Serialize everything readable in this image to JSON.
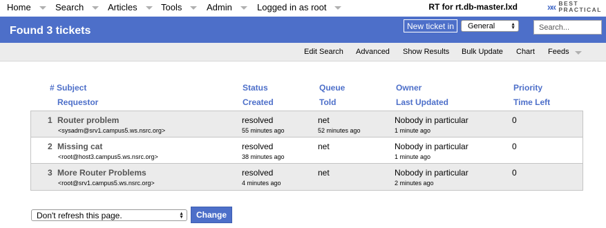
{
  "menu": {
    "items": [
      {
        "label": "Home"
      },
      {
        "label": "Search"
      },
      {
        "label": "Articles"
      },
      {
        "label": "Tools"
      },
      {
        "label": "Admin"
      },
      {
        "label": "Logged in as root"
      }
    ],
    "rt_title": "RT for rt.db-master.lxd",
    "logo_line1": "BEST",
    "logo_line2": "PRACTICAL"
  },
  "header": {
    "title": "Found 3 tickets",
    "new_ticket_label": "New ticket in",
    "queue_selected": "General",
    "search_placeholder": "Search..."
  },
  "subnav": {
    "items": [
      "Edit Search",
      "Advanced",
      "Show Results",
      "Bulk Update",
      "Chart",
      "Feeds"
    ]
  },
  "columns": {
    "row1": [
      "# Subject",
      "Status",
      "Queue",
      "Owner",
      "Priority"
    ],
    "row2": [
      "Requestor",
      "Created",
      "Told",
      "Last Updated",
      "Time Left"
    ]
  },
  "tickets": [
    {
      "id": "1",
      "subject": "Router problem",
      "status": "resolved",
      "queue": "net",
      "owner": "Nobody in particular",
      "priority": "0",
      "requestor": "<sysadm@srv1.campus5.ws.nsrc.org>",
      "created": "55 minutes ago",
      "told": "52 minutes ago",
      "last_updated": "1 minute ago",
      "time_left": ""
    },
    {
      "id": "2",
      "subject": "Missing cat",
      "status": "resolved",
      "queue": "net",
      "owner": "Nobody in particular",
      "priority": "0",
      "requestor": "<root@host3.campus5.ws.nsrc.org>",
      "created": "38 minutes ago",
      "told": "",
      "last_updated": "1 minute ago",
      "time_left": ""
    },
    {
      "id": "3",
      "subject": "More Router Problems",
      "status": "resolved",
      "queue": "net",
      "owner": "Nobody in particular",
      "priority": "0",
      "requestor": "<root@srv1.campus5.ws.nsrc.org>",
      "created": "4 minutes ago",
      "told": "",
      "last_updated": "2 minutes ago",
      "time_left": ""
    }
  ],
  "footer": {
    "refresh_selected": "Don't refresh this page.",
    "change_label": "Change"
  },
  "colors": {
    "accent": "#4d6fc9",
    "row_shade": "#ebebeb",
    "subnav_bg": "#ececec"
  }
}
